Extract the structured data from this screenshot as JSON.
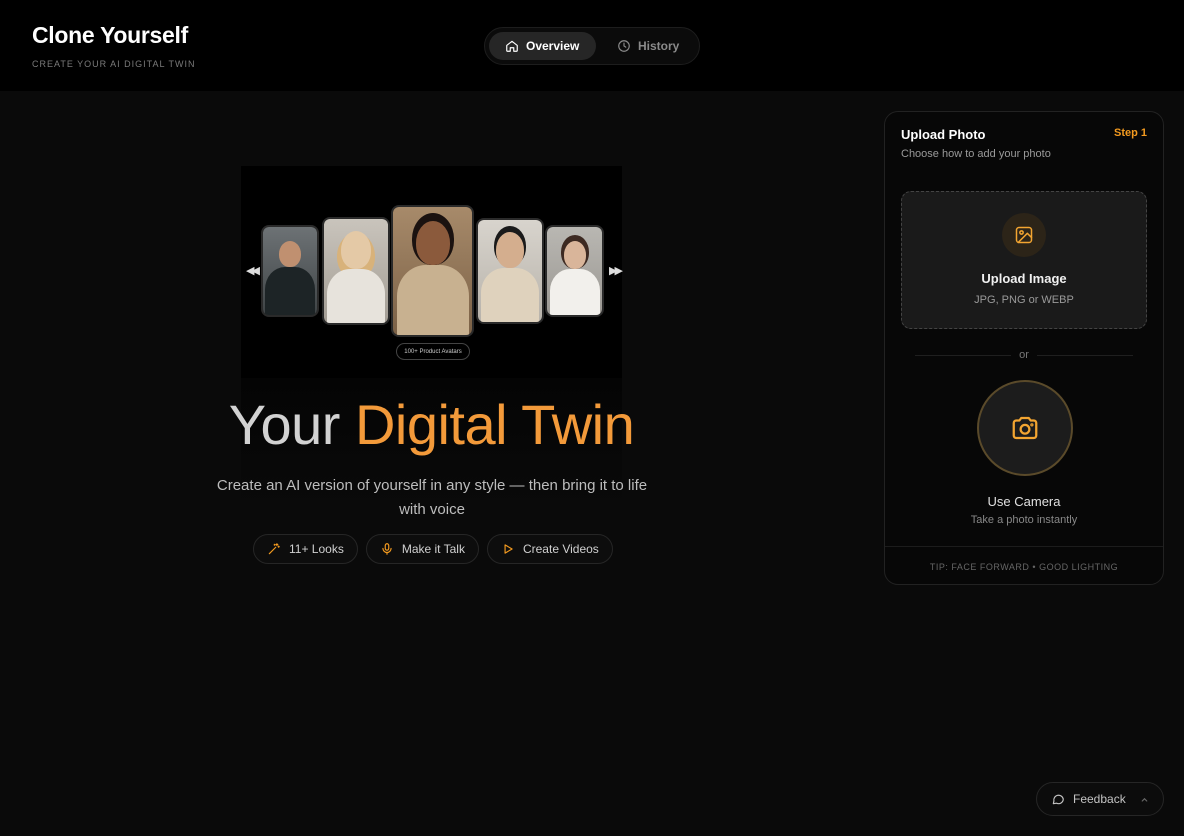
{
  "brand": {
    "title": "Clone Yourself",
    "subtitle": "CREATE YOUR AI DIGITAL TWIN"
  },
  "nav": {
    "tabs": [
      {
        "label": "Overview",
        "icon": "home-icon",
        "active": true
      },
      {
        "label": "History",
        "icon": "clock-icon",
        "active": false
      }
    ]
  },
  "hero": {
    "media_badge": "100+ Product Avatars",
    "title_part1": "Your ",
    "title_part2": "Digital Twin",
    "subtitle": "Create an AI version of yourself in any style — then bring it to life with voice",
    "chips": [
      {
        "label": "11+ Looks",
        "icon": "magic-wand-icon"
      },
      {
        "label": "Make it Talk",
        "icon": "microphone-icon"
      },
      {
        "label": "Create Videos",
        "icon": "play-icon"
      }
    ]
  },
  "upload_panel": {
    "title": "Upload Photo",
    "step": "Step 1",
    "description": "Choose how to add your photo",
    "upload": {
      "title": "Upload Image",
      "formats": "JPG, PNG or WEBP",
      "icon": "image-icon"
    },
    "divider": "or",
    "camera": {
      "title": "Use Camera",
      "subtitle": "Take a photo instantly",
      "icon": "camera-icon"
    },
    "tip": "TIP: FACE FORWARD • GOOD LIGHTING"
  },
  "feedback": {
    "label": "Feedback",
    "icon": "chat-bubble-icon"
  },
  "colors": {
    "accent": "#f39a1f",
    "background": "#0a0a0a"
  }
}
